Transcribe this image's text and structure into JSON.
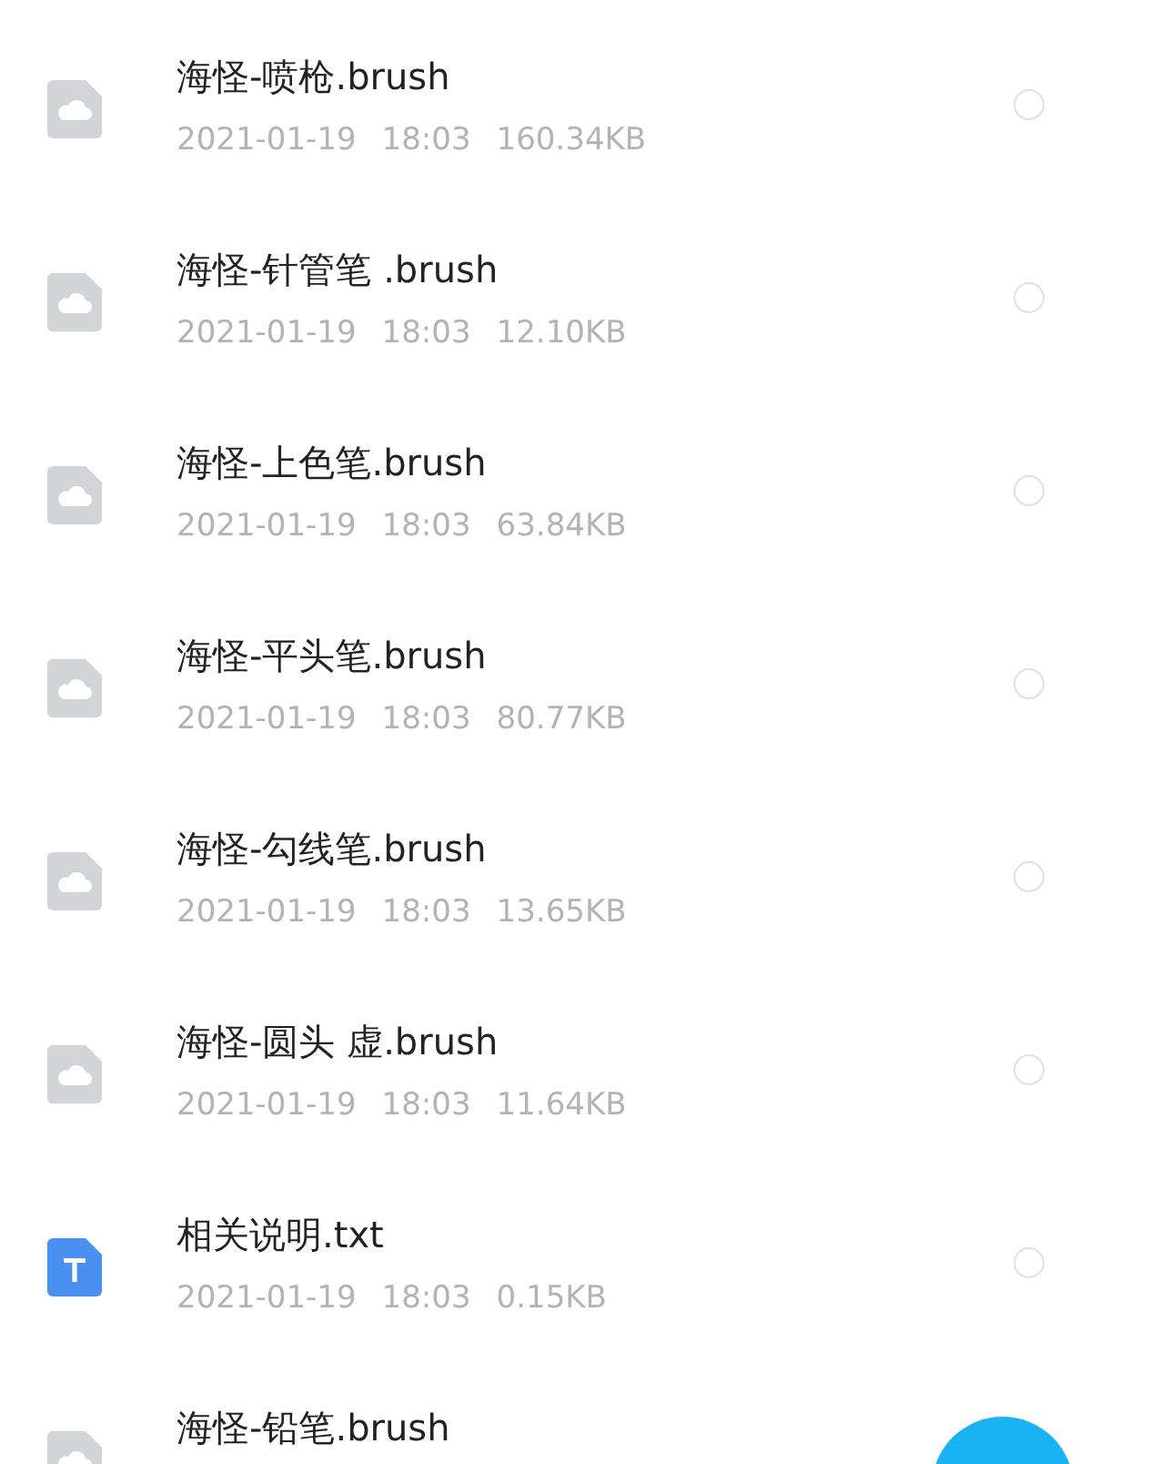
{
  "files": [
    {
      "kind": "brush",
      "name": "海怪-喷枪.brush",
      "date": "2021-01-19",
      "time": "18:03",
      "size": "160.34KB",
      "selected": false
    },
    {
      "kind": "brush",
      "name": "海怪-针管笔 .brush",
      "date": "2021-01-19",
      "time": "18:03",
      "size": "12.10KB",
      "selected": false
    },
    {
      "kind": "brush",
      "name": "海怪-上色笔.brush",
      "date": "2021-01-19",
      "time": "18:03",
      "size": "63.84KB",
      "selected": false
    },
    {
      "kind": "brush",
      "name": "海怪-平头笔.brush",
      "date": "2021-01-19",
      "time": "18:03",
      "size": "80.77KB",
      "selected": false
    },
    {
      "kind": "brush",
      "name": "海怪-勾线笔.brush",
      "date": "2021-01-19",
      "time": "18:03",
      "size": "13.65KB",
      "selected": false
    },
    {
      "kind": "brush",
      "name": "海怪-圆头 虚.brush",
      "date": "2021-01-19",
      "time": "18:03",
      "size": "11.64KB",
      "selected": false
    },
    {
      "kind": "text",
      "name": "相关说明.txt",
      "date": "2021-01-19",
      "time": "18:03",
      "size": "0.15KB",
      "selected": false
    },
    {
      "kind": "brush",
      "name": "海怪-铅笔.brush"
    }
  ]
}
